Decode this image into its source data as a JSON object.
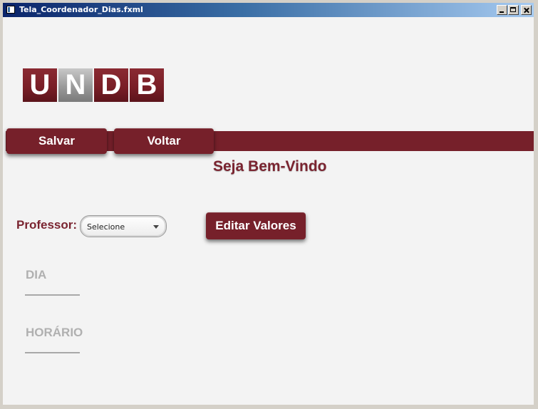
{
  "window": {
    "title": "Tela_Coordenador_Dias.fxml",
    "icons": {
      "app": "app-window-icon",
      "minimize": "minimize-icon",
      "maximize": "maximize-icon",
      "close": "close-icon"
    }
  },
  "logo": {
    "letters": [
      "U",
      "N",
      "D",
      "B"
    ],
    "brand_color": "#7a1f27"
  },
  "toolbar": {
    "save_label": "Salvar",
    "back_label": "Voltar",
    "accent": "#76202a"
  },
  "header": {
    "welcome": "Seja Bem-Vindo"
  },
  "form": {
    "professor_label": "Professor:",
    "professor_select": {
      "selected": "Selecione",
      "icon": "chevron-down-icon"
    },
    "edit_button_label": "Editar Valores",
    "day_field_label": "DIA",
    "time_field_label": "HORÁRIO"
  }
}
